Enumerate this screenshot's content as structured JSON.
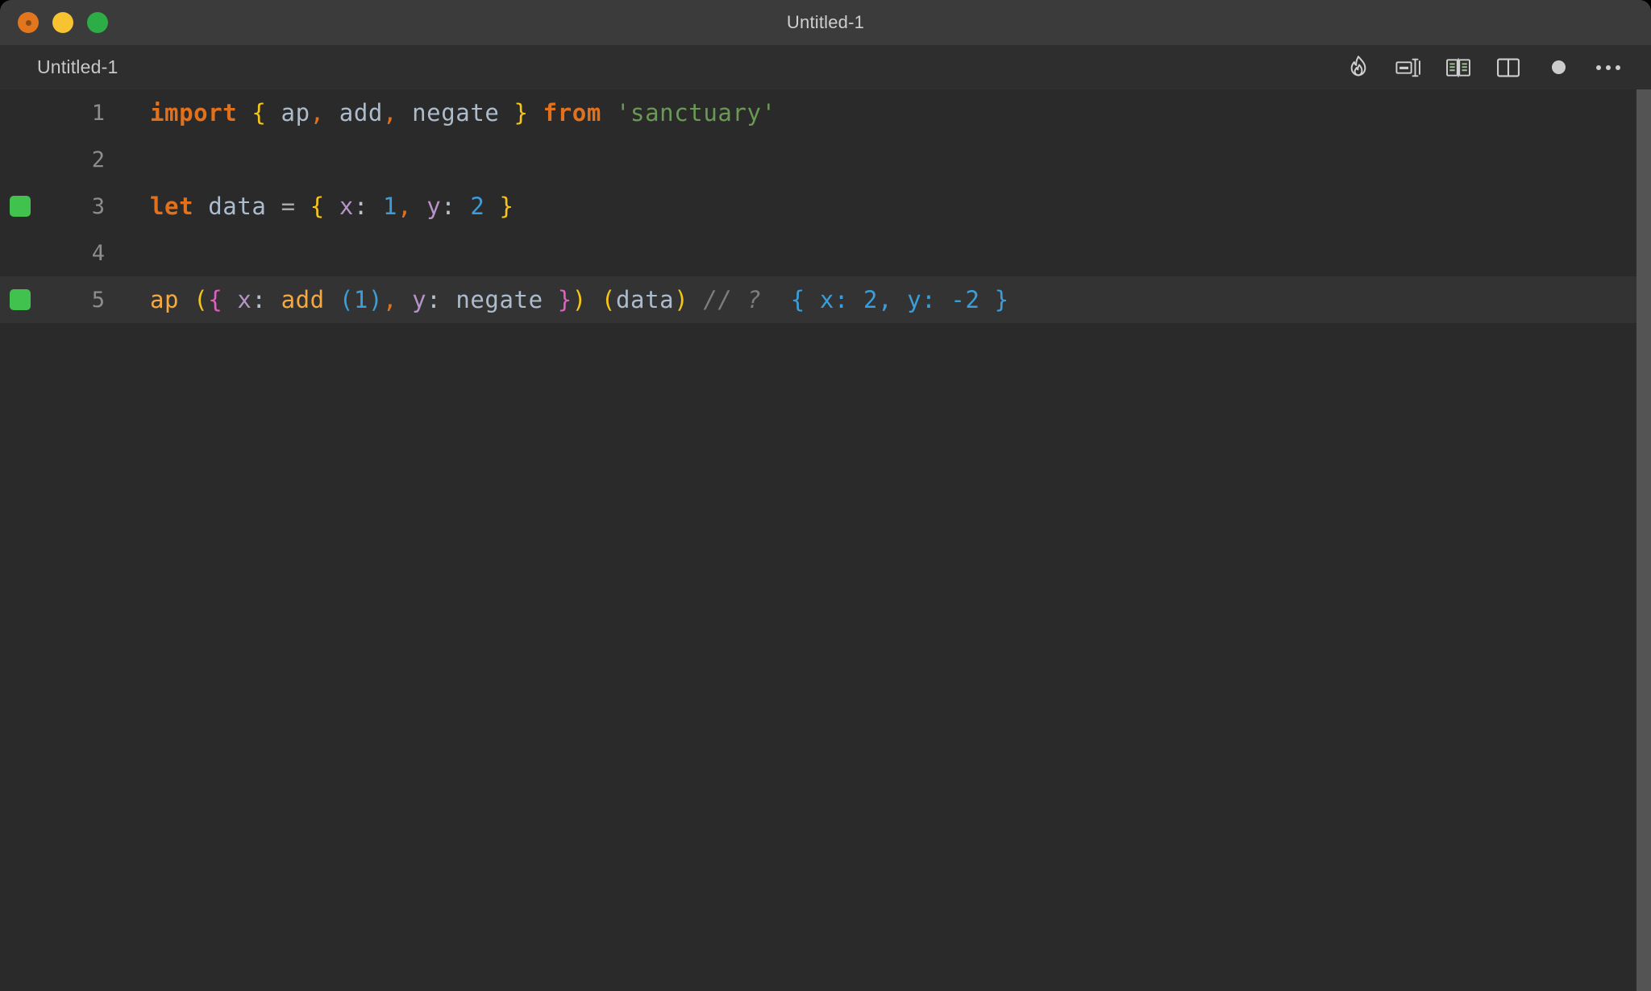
{
  "window": {
    "title": "Untitled-1",
    "traffic_lights": [
      {
        "name": "close",
        "color": "#e2761f"
      },
      {
        "name": "minimize",
        "color": "#f7c331"
      },
      {
        "name": "maximize",
        "color": "#2cad45"
      }
    ]
  },
  "tabbar": {
    "tabs": [
      {
        "label": "Untitled-1",
        "active": true
      }
    ],
    "toolbar_icons": [
      {
        "name": "flame-icon",
        "label": "Run / Quokka"
      },
      {
        "name": "format-document-icon",
        "label": "Format Document"
      },
      {
        "name": "open-book-icon",
        "label": "Open Preview"
      },
      {
        "name": "split-editor-icon",
        "label": "Split Editor"
      },
      {
        "name": "unsaved-dot-icon",
        "label": "Unsaved changes"
      },
      {
        "name": "more-actions-ellipsis-icon",
        "label": "More Actions..."
      }
    ]
  },
  "editor": {
    "background": "#2a2a2a",
    "active_line_background": "#333333",
    "gutter_marker_color": "#41c14e",
    "lines": [
      {
        "number": "1",
        "marker": false,
        "active": false,
        "text": "import { ap, add, negate } from 'sanctuary'",
        "tokens": [
          {
            "t": "import",
            "c": "t-keyword"
          },
          {
            "t": " ",
            "c": "t-op"
          },
          {
            "t": "{",
            "c": "t-brace"
          },
          {
            "t": " ",
            "c": "t-op"
          },
          {
            "t": "ap",
            "c": "t-ident"
          },
          {
            "t": ",",
            "c": "t-comma"
          },
          {
            "t": " ",
            "c": "t-op"
          },
          {
            "t": "add",
            "c": "t-ident"
          },
          {
            "t": ",",
            "c": "t-comma"
          },
          {
            "t": " ",
            "c": "t-op"
          },
          {
            "t": "negate",
            "c": "t-ident"
          },
          {
            "t": " ",
            "c": "t-op"
          },
          {
            "t": "}",
            "c": "t-brace"
          },
          {
            "t": " ",
            "c": "t-op"
          },
          {
            "t": "from",
            "c": "t-keyword"
          },
          {
            "t": " ",
            "c": "t-op"
          },
          {
            "t": "'sanctuary'",
            "c": "t-string"
          }
        ]
      },
      {
        "number": "2",
        "marker": false,
        "active": false,
        "text": "",
        "tokens": []
      },
      {
        "number": "3",
        "marker": true,
        "active": false,
        "text": "let data = { x: 1, y: 2 }",
        "tokens": [
          {
            "t": "let",
            "c": "t-keyword"
          },
          {
            "t": " ",
            "c": "t-op"
          },
          {
            "t": "data",
            "c": "t-ident"
          },
          {
            "t": " ",
            "c": "t-op"
          },
          {
            "t": "=",
            "c": "t-op"
          },
          {
            "t": " ",
            "c": "t-op"
          },
          {
            "t": "{",
            "c": "t-brace"
          },
          {
            "t": " ",
            "c": "t-op"
          },
          {
            "t": "x",
            "c": "t-key"
          },
          {
            "t": ":",
            "c": "t-colon"
          },
          {
            "t": " ",
            "c": "t-op"
          },
          {
            "t": "1",
            "c": "t-number"
          },
          {
            "t": ",",
            "c": "t-comma"
          },
          {
            "t": " ",
            "c": "t-op"
          },
          {
            "t": "y",
            "c": "t-key"
          },
          {
            "t": ":",
            "c": "t-colon"
          },
          {
            "t": " ",
            "c": "t-op"
          },
          {
            "t": "2",
            "c": "t-number"
          },
          {
            "t": " ",
            "c": "t-op"
          },
          {
            "t": "}",
            "c": "t-brace"
          }
        ]
      },
      {
        "number": "4",
        "marker": false,
        "active": false,
        "text": "",
        "tokens": []
      },
      {
        "number": "5",
        "marker": true,
        "active": true,
        "text": "ap ({ x: add (1), y: negate }) (data) // ?  { x: 2, y: -2 }",
        "tokens": [
          {
            "t": "ap",
            "c": "t-func"
          },
          {
            "t": " ",
            "c": "t-op"
          },
          {
            "t": "(",
            "c": "t-brace"
          },
          {
            "t": "{",
            "c": "t-brace-pink"
          },
          {
            "t": " ",
            "c": "t-op"
          },
          {
            "t": "x",
            "c": "t-key"
          },
          {
            "t": ":",
            "c": "t-colon"
          },
          {
            "t": " ",
            "c": "t-op"
          },
          {
            "t": "add",
            "c": "t-func"
          },
          {
            "t": " ",
            "c": "t-op"
          },
          {
            "t": "(",
            "c": "t-paren-blue"
          },
          {
            "t": "1",
            "c": "t-number"
          },
          {
            "t": ")",
            "c": "t-paren-blue"
          },
          {
            "t": ",",
            "c": "t-comma"
          },
          {
            "t": " ",
            "c": "t-op"
          },
          {
            "t": "y",
            "c": "t-key"
          },
          {
            "t": ":",
            "c": "t-colon"
          },
          {
            "t": " ",
            "c": "t-op"
          },
          {
            "t": "negate",
            "c": "t-ident"
          },
          {
            "t": " ",
            "c": "t-op"
          },
          {
            "t": "}",
            "c": "t-brace-pink"
          },
          {
            "t": ")",
            "c": "t-brace"
          },
          {
            "t": " ",
            "c": "t-op"
          },
          {
            "t": "(",
            "c": "t-brace"
          },
          {
            "t": "data",
            "c": "t-ident"
          },
          {
            "t": ")",
            "c": "t-brace"
          },
          {
            "t": " ",
            "c": "t-op"
          },
          {
            "t": "// ?",
            "c": "t-comment"
          },
          {
            "t": "  ",
            "c": "t-op"
          },
          {
            "t": "{ x: 2, y: -2 }",
            "c": "t-result"
          }
        ]
      }
    ]
  }
}
